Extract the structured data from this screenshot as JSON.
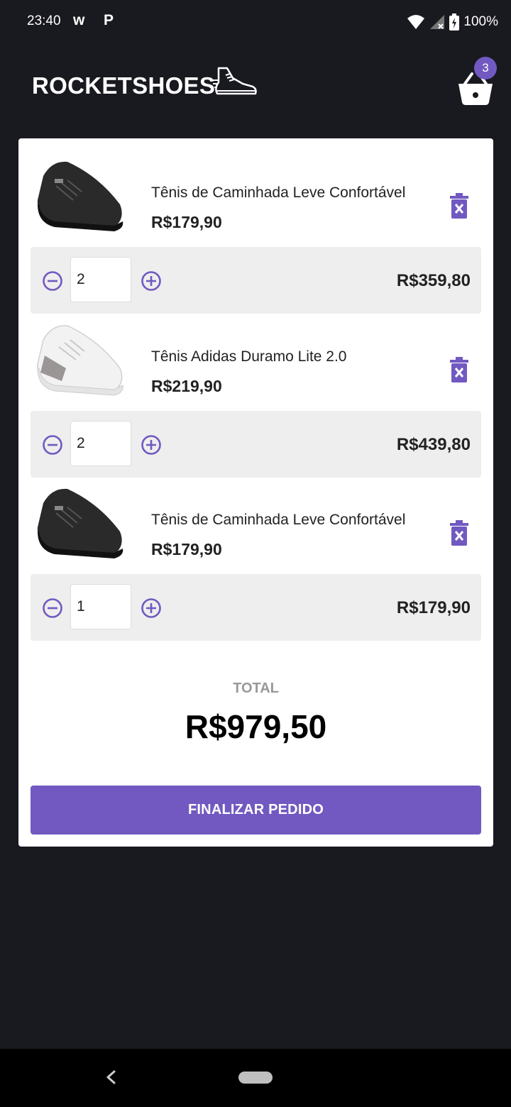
{
  "status": {
    "time": "23:40",
    "app_icons": [
      "w",
      "P"
    ],
    "battery": "100%"
  },
  "header": {
    "brand": "ROCKETSHOES",
    "cart_count": "3"
  },
  "cart": {
    "items": [
      {
        "title": "Tênis de Caminhada Leve Confortável",
        "price": "R$179,90",
        "quantity": "2",
        "subtotal": "R$359,80",
        "shoe_color": "black"
      },
      {
        "title": "Tênis Adidas Duramo Lite 2.0",
        "price": "R$219,90",
        "quantity": "2",
        "subtotal": "R$439,80",
        "shoe_color": "white"
      },
      {
        "title": "Tênis de Caminhada Leve Confortável",
        "price": "R$179,90",
        "quantity": "1",
        "subtotal": "R$179,90",
        "shoe_color": "black"
      }
    ],
    "total_label": "TOTAL",
    "total_value": "R$979,50",
    "finish_label": "FINALIZAR PEDIDO"
  },
  "colors": {
    "background": "#191920",
    "accent": "#7159c1",
    "panel": "#ffffff",
    "qty_row": "#eeeeee"
  },
  "icons": {
    "delete": "trash-icon",
    "minus": "minus-circle-icon",
    "plus": "plus-circle-icon",
    "cart": "basket-icon",
    "brand": "shoe-icon"
  }
}
